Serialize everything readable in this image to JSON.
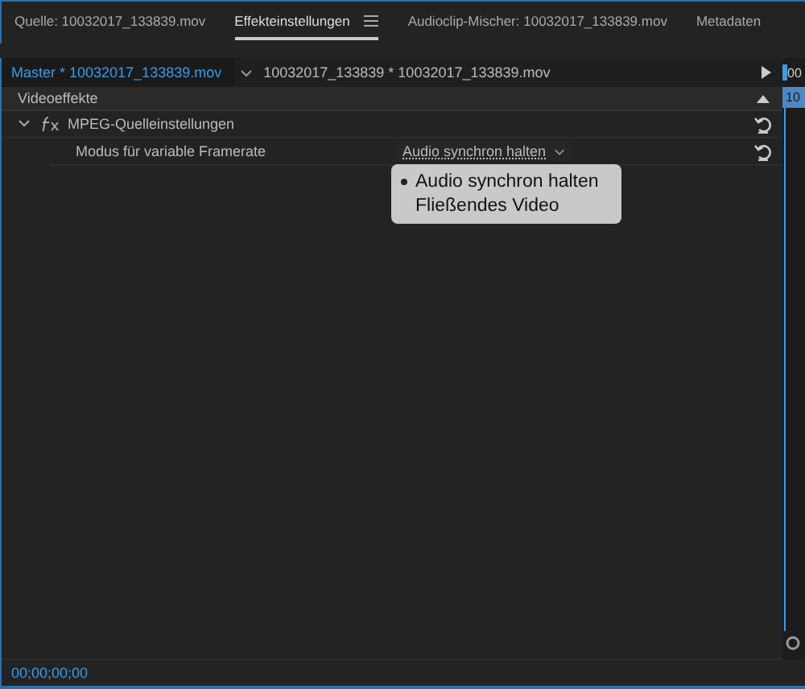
{
  "tabs": [
    {
      "label": "Quelle: 10032017_133839.mov",
      "selected": false,
      "has_menu": false
    },
    {
      "label": "Effekteinstellungen",
      "selected": true,
      "has_menu": true
    },
    {
      "label": "Audioclip-Mischer: 10032017_133839.mov",
      "selected": false,
      "has_menu": false
    },
    {
      "label": "Metadaten",
      "selected": false,
      "has_menu": false
    }
  ],
  "clip_bar": {
    "master": "Master * 10032017_133839.mov",
    "clip": "10032017_133839 * 10032017_133839.mov"
  },
  "section": {
    "title": "Videoeffekte",
    "expanded": true
  },
  "effects": [
    {
      "name": "MPEG-Quelleinstellungen",
      "expanded": true,
      "properties": [
        {
          "label": "Modus für variable Framerate",
          "value": "Audio synchron halten",
          "options": [
            {
              "label": "Audio synchron halten",
              "selected": true
            },
            {
              "label": "Fließendes Video",
              "selected": false
            }
          ]
        }
      ]
    }
  ],
  "timeline": {
    "ruler": "00",
    "clip": "10"
  },
  "timecode": "00;00;00;00"
}
